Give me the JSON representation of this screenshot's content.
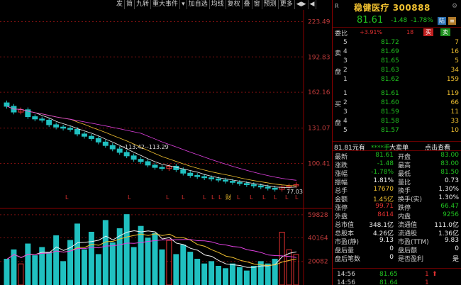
{
  "toolbar": {
    "items": [
      "发",
      "简",
      "九转",
      "重大事件",
      "▾",
      "加自选",
      "均线",
      "复权",
      "叠",
      "窗",
      "预测",
      "更多",
      "◀▶",
      "◀"
    ]
  },
  "chart_data": [
    {
      "type": "candlestick",
      "title": "",
      "ylim": [
        70,
        225
      ],
      "yticks": [
        223.49,
        192.83,
        162.16,
        131.07,
        100.41
      ],
      "markers": [
        "L",
        "L",
        "L",
        "L",
        "L",
        "L",
        "L",
        "财",
        "L",
        "L",
        "L",
        "L",
        "L",
        "L"
      ],
      "annotations": {
        "range_label": "113.42--113.29",
        "low_label": "77.03"
      },
      "series": [
        {
          "name": "",
          "values": [
            150,
            145,
            147,
            141,
            139,
            138,
            134,
            132,
            131,
            130,
            126,
            124,
            122,
            119,
            116,
            113,
            110,
            107,
            104,
            102,
            99,
            97,
            96,
            98,
            95,
            92,
            90,
            89,
            88,
            87,
            86,
            85,
            84,
            83,
            82,
            81,
            80,
            79,
            78,
            80,
            81,
            82
          ]
        }
      ]
    },
    {
      "type": "bar",
      "title": "",
      "yticks": [
        59828,
        40164,
        20082
      ],
      "series": [
        {
          "name": "",
          "values": [
            22000,
            30000,
            18000,
            35000,
            25000,
            32000,
            28000,
            42000,
            20000,
            38000,
            52000,
            30000,
            45000,
            26000,
            55000,
            36000,
            48000,
            60000,
            32000,
            50000,
            40000,
            44000,
            30000,
            38000,
            26000,
            34000,
            28000,
            22000,
            18000,
            20000,
            16000,
            14000,
            18000,
            15000,
            12000,
            16000,
            20000,
            18000,
            22000,
            45000,
            30000,
            26000
          ]
        }
      ]
    }
  ],
  "stock": {
    "r": "R",
    "name": "稳健医疗",
    "code": "300888",
    "price": "81.61",
    "change": "-1.48",
    "pct": "-1.78%",
    "badge1": "陆",
    "badge2": "≡"
  },
  "weibi": {
    "label": "委比",
    "v1": "+3.91%",
    "v2": "18",
    "buy": "买",
    "sell": "卖"
  },
  "asks": [
    {
      "side": "",
      "lvl": "5",
      "price": "81.72",
      "vol": "7"
    },
    {
      "side": "卖",
      "lvl": "4",
      "price": "81.69",
      "vol": "16"
    },
    {
      "side": "",
      "lvl": "3",
      "price": "81.65",
      "vol": "5"
    },
    {
      "side": "盘",
      "lvl": "2",
      "price": "81.63",
      "vol": "34"
    },
    {
      "side": "",
      "lvl": "1",
      "price": "81.62",
      "vol": "159"
    }
  ],
  "bids": [
    {
      "side": "",
      "lvl": "1",
      "price": "81.61",
      "vol": "119"
    },
    {
      "side": "买",
      "lvl": "2",
      "price": "81.60",
      "vol": "66"
    },
    {
      "side": "",
      "lvl": "3",
      "price": "81.59",
      "vol": "11"
    },
    {
      "side": "盘",
      "lvl": "4",
      "price": "81.58",
      "vol": "33"
    },
    {
      "side": "",
      "lvl": "5",
      "price": "81.57",
      "vol": "10"
    }
  ],
  "midbar": {
    "a": "81.81元有",
    "b": "****手",
    "c": "大卖单",
    "d": "点击查看"
  },
  "stats": [
    {
      "k1": "最新",
      "v1": "81.61",
      "c1": "grn",
      "k2": "开盘",
      "v2": "83.00",
      "c2": "grn"
    },
    {
      "k1": "涨跌",
      "v1": "-1.48",
      "c1": "grn",
      "k2": "最高",
      "v2": "83.00",
      "c2": "grn"
    },
    {
      "k1": "涨幅",
      "v1": "-1.78%",
      "c1": "grn",
      "k2": "最低",
      "v2": "81.50",
      "c2": "grn"
    },
    {
      "k1": "振幅",
      "v1": "1.81%",
      "c1": "wht",
      "k2": "量比",
      "v2": "0.73",
      "c2": "wht"
    },
    {
      "k1": "总手",
      "v1": "17670",
      "c1": "yel",
      "k2": "换手",
      "v2": "1.30%",
      "c2": "wht"
    },
    {
      "k1": "金额",
      "v1": "1.45亿",
      "c1": "yel",
      "k2": "换手(实)",
      "v2": "1.30%",
      "c2": "wht"
    },
    {
      "k1": "涨停",
      "v1": "99.71",
      "c1": "red",
      "k2": "跌停",
      "v2": "66.47",
      "c2": "grn"
    },
    {
      "k1": "外盘",
      "v1": "8414",
      "c1": "red",
      "k2": "内盘",
      "v2": "9256",
      "c2": "grn"
    },
    {
      "k1": "总市值",
      "v1": "348.1亿",
      "c1": "wht",
      "k2": "流通值",
      "v2": "111.0亿",
      "c2": "wht"
    },
    {
      "k1": "总股本",
      "v1": "4.26亿",
      "c1": "wht",
      "k2": "流通股",
      "v2": "1.36亿",
      "c2": "wht"
    },
    {
      "k1": "市盈(静)",
      "v1": "9.13",
      "c1": "wht",
      "k2": "市盈(TTM)",
      "v2": "9.83",
      "c2": "wht"
    },
    {
      "k1": "盘后量",
      "v1": "0",
      "c1": "wht",
      "k2": "盘后额",
      "v2": "0",
      "c2": "wht"
    },
    {
      "k1": "盘后笔数",
      "v1": "0",
      "c1": "wht",
      "k2": "是否盈利",
      "v2": "是",
      "c2": "wht"
    }
  ],
  "ticks": [
    {
      "t": "14:56",
      "p": "81.65",
      "v": "1",
      "ar": "⬆"
    },
    {
      "t": "14:56",
      "p": "81.64",
      "v": "1",
      "ar": ""
    }
  ]
}
